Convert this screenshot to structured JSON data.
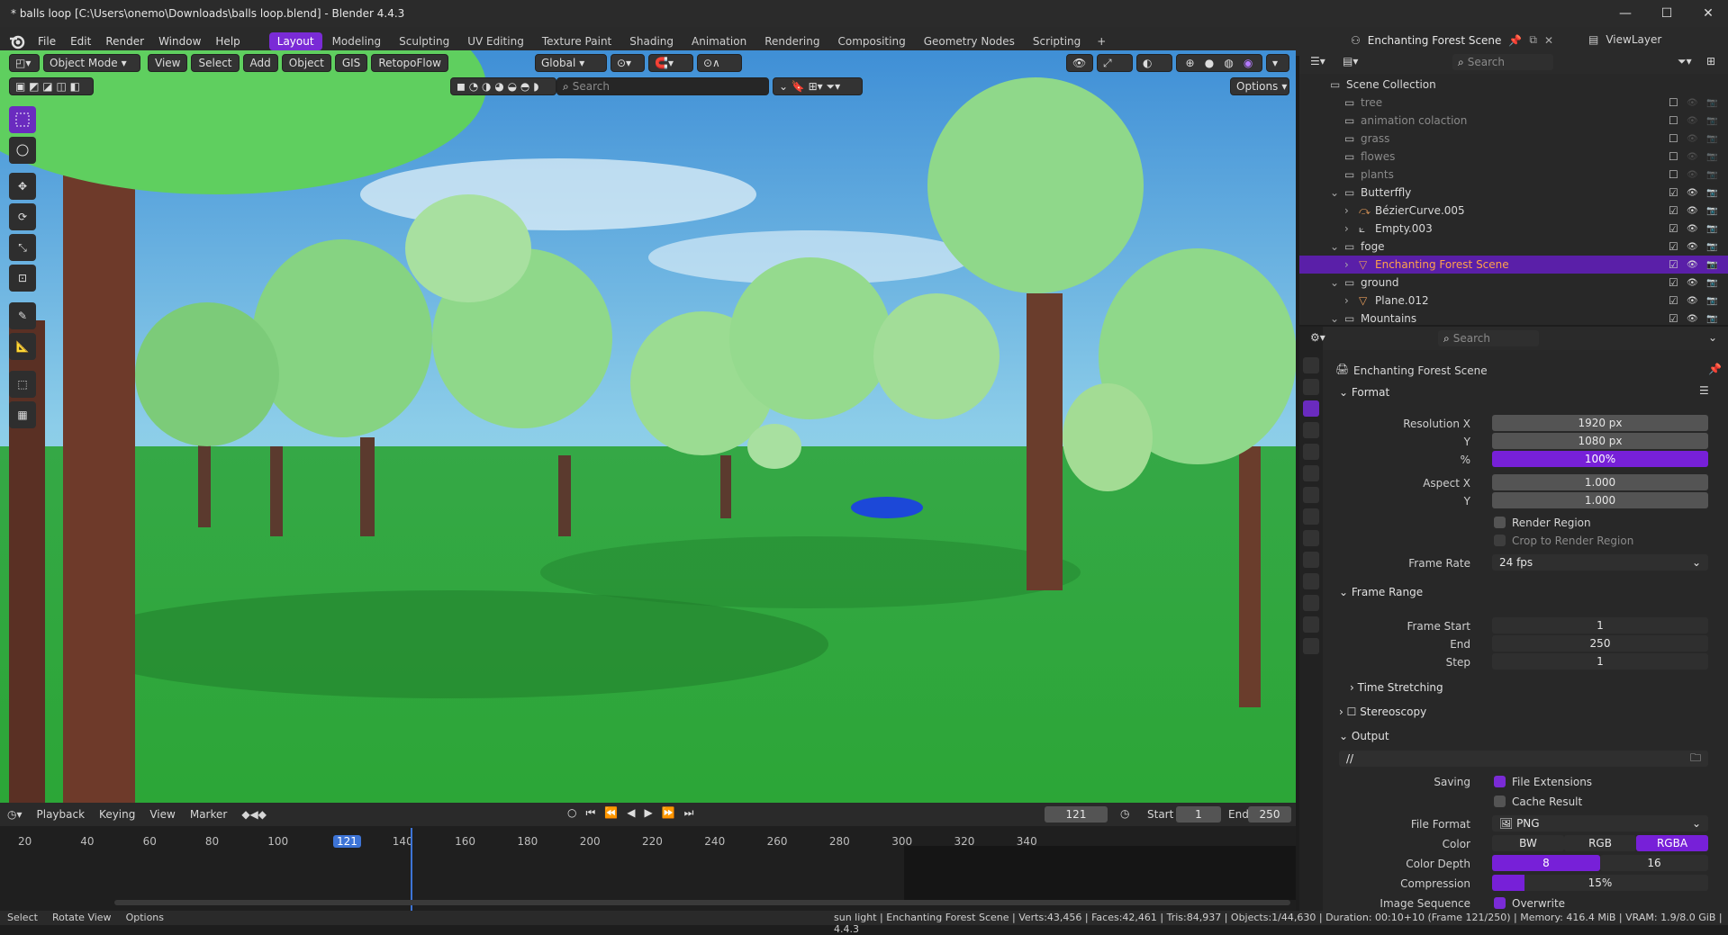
{
  "window": {
    "title": "* balls loop [C:\\Users\\onemo\\Downloads\\balls loop.blend] - Blender 4.4.3",
    "min": "—",
    "max": "☐",
    "close": "✕"
  },
  "menu": {
    "items": [
      "File",
      "Edit",
      "Render",
      "Window",
      "Help"
    ],
    "workspaces": [
      "Layout",
      "Modeling",
      "Sculpting",
      "UV Editing",
      "Texture Paint",
      "Shading",
      "Animation",
      "Rendering",
      "Compositing",
      "Geometry Nodes",
      "Scripting"
    ],
    "active_workspace": "Layout",
    "add_tab": "+",
    "scene_name": "Enchanting Forest Scene",
    "view_layer": "ViewLayer"
  },
  "viewport": {
    "mode": "Object Mode",
    "menus": [
      "View",
      "Select",
      "Add",
      "Object",
      "GIS",
      "RetopoFlow"
    ],
    "orientation": "Global",
    "search_placeholder": "Search",
    "options": "Options"
  },
  "outliner": {
    "search_placeholder": "Search",
    "rows": [
      {
        "name": "Scene Collection",
        "indent": 0,
        "type": "scene",
        "dim": false
      },
      {
        "name": "tree",
        "indent": 1,
        "type": "collection",
        "dim": true
      },
      {
        "name": "animation colaction",
        "indent": 1,
        "type": "collection",
        "dim": true
      },
      {
        "name": "grass",
        "indent": 1,
        "type": "collection",
        "dim": true
      },
      {
        "name": "flowes",
        "indent": 1,
        "type": "collection",
        "dim": true
      },
      {
        "name": "plants",
        "indent": 1,
        "type": "collection",
        "dim": true
      },
      {
        "name": "Butterffly",
        "indent": 1,
        "type": "collection",
        "dim": false
      },
      {
        "name": "BézierCurve.005",
        "indent": 2,
        "type": "curve",
        "dim": false
      },
      {
        "name": "Empty.003",
        "indent": 2,
        "type": "empty",
        "dim": false
      },
      {
        "name": "foge",
        "indent": 1,
        "type": "collection",
        "dim": false
      },
      {
        "name": "Enchanting Forest Scene",
        "indent": 2,
        "type": "mesh",
        "dim": false,
        "selected": true
      },
      {
        "name": "ground",
        "indent": 1,
        "type": "collection",
        "dim": false
      },
      {
        "name": "Plane.012",
        "indent": 2,
        "type": "mesh",
        "dim": false
      },
      {
        "name": "Mountains",
        "indent": 1,
        "type": "collection",
        "dim": false
      }
    ]
  },
  "properties": {
    "search_placeholder": "Search",
    "scene_name": "Enchanting Forest Scene",
    "format": {
      "header": "Format",
      "res_x_label": "Resolution X",
      "res_x": "1920 px",
      "res_y_label": "Y",
      "res_y": "1080 px",
      "pct_label": "%",
      "pct": "100%",
      "aspect_x_label": "Aspect X",
      "aspect_x": "1.000",
      "aspect_y_label": "Y",
      "aspect_y": "1.000",
      "render_region": "Render Region",
      "crop": "Crop to Render Region",
      "frame_rate_label": "Frame Rate",
      "frame_rate": "24 fps"
    },
    "frame_range": {
      "header": "Frame Range",
      "start_label": "Frame Start",
      "start": "1",
      "end_label": "End",
      "end": "250",
      "step_label": "Step",
      "step": "1",
      "time_stretching": "Time Stretching",
      "stereoscopy": "Stereoscopy"
    },
    "output": {
      "header": "Output",
      "path": "//",
      "saving_label": "Saving",
      "file_ext": "File Extensions",
      "cache": "Cache Result",
      "format_label": "File Format",
      "format": "PNG",
      "color_label": "Color",
      "bw": "BW",
      "rgb": "RGB",
      "rgba": "RGBA",
      "depth_label": "Color Depth",
      "d8": "8",
      "d16": "16",
      "compression_label": "Compression",
      "compression": "15%",
      "compression_level": 0.15,
      "seq_label": "Image Sequence",
      "overwrite": "Overwrite"
    }
  },
  "timeline": {
    "menus": [
      "Playback",
      "Keying",
      "View",
      "Marker"
    ],
    "current_frame": "121",
    "start_label": "Start",
    "start": "1",
    "end_label": "End",
    "end": "250",
    "ticks": [
      "20",
      "40",
      "60",
      "80",
      "100",
      "121",
      "140",
      "160",
      "180",
      "200",
      "220",
      "240",
      "260",
      "280",
      "300",
      "320",
      "340"
    ]
  },
  "status": {
    "left": [
      "Select",
      "Rotate View",
      "Options"
    ],
    "right": "sun light | Enchanting Forest Scene | Verts:43,456 | Faces:42,461 | Tris:84,937 | Objects:1/44,630 | Duration: 00:10+10 (Frame 121/250) | Memory: 416.4 MiB | VRAM: 1.9/8.0 GiB | 4.4.3"
  }
}
